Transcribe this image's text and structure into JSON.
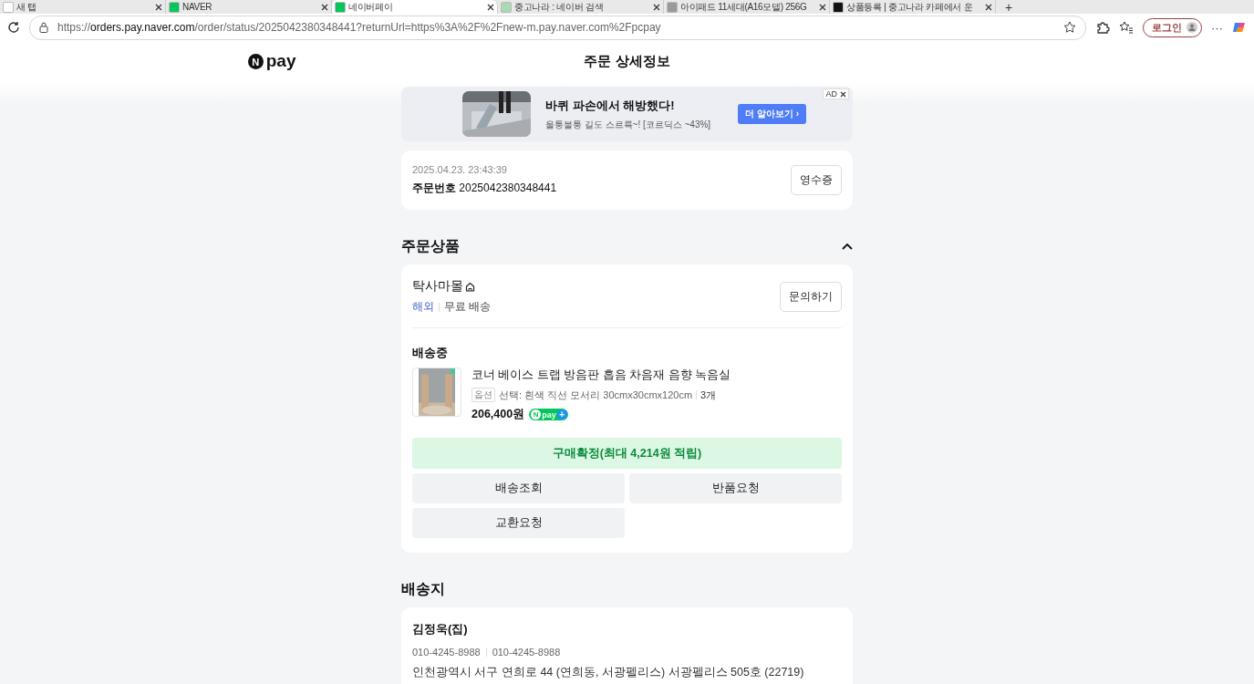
{
  "browser": {
    "tabs": [
      {
        "title": "새 탭",
        "selected": false
      },
      {
        "title": "NAVER",
        "selected": false
      },
      {
        "title": "네이버페이",
        "selected": true
      },
      {
        "title": "중고나라 : 네이버 검색",
        "selected": false
      },
      {
        "title": "아이패드 11세대(A16모델) 256G",
        "selected": false
      },
      {
        "title": "상품등록 | 중고나라 카페에서 운",
        "selected": false
      }
    ],
    "new_tab": "+",
    "address": {
      "scheme": "https://",
      "host": "orders.pay.naver.com",
      "path": "/order/status/2025042380348441?returnUrl=https%3A%2F%2Fnew-m.pay.naver.com%2Fpcpay"
    },
    "profile_button": "로그인",
    "more": "···"
  },
  "header": {
    "logo_mark": "N",
    "logo_text": "pay",
    "title": "주문 상세정보"
  },
  "ad": {
    "headline": "바퀴 파손에서 해방했다!",
    "subtext": "울퉁불퉁 길도 스르륵~! [코르딕스 ~43%]",
    "cta": "더 알아보기 ›",
    "badge": "AD"
  },
  "order": {
    "datetime": "2025.04.23. 23:43:39",
    "number_label": "주문번호",
    "number": "2025042380348441",
    "receipt_button": "영수증"
  },
  "products": {
    "title": "주문상품",
    "expanded": true,
    "store": "탁사마몰",
    "tags": [
      {
        "text": "해외",
        "color": "#5b7bd5"
      },
      {
        "text": "무료 배송",
        "color": "#666666"
      }
    ],
    "inquiry_button": "문의하기",
    "status": "배송중",
    "item": {
      "name": "코너 베이스 트랩 방음판 흡음 차음재 음향 녹음실",
      "option_label": "옵션",
      "option": "선택: 흰색 직선 모서리 30cmx30cmx120cm",
      "quantity": "3개",
      "price": "206,400원",
      "badge_mark": "N",
      "badge_text": "pay",
      "badge_plus": "+"
    },
    "confirm_button": "구매확정(최대 4,214원 적립)",
    "actions": [
      "배송조회",
      "반품요청",
      "교환요청"
    ]
  },
  "shipping": {
    "title": "배송지",
    "name": "김정욱(집)",
    "phones": [
      "010-4245-8988",
      "010-4245-8988"
    ],
    "address": "인천광역시 서구 연희로 44 (연희동, 서광펠리스) 서광펠리스 505호 (22719)"
  }
}
